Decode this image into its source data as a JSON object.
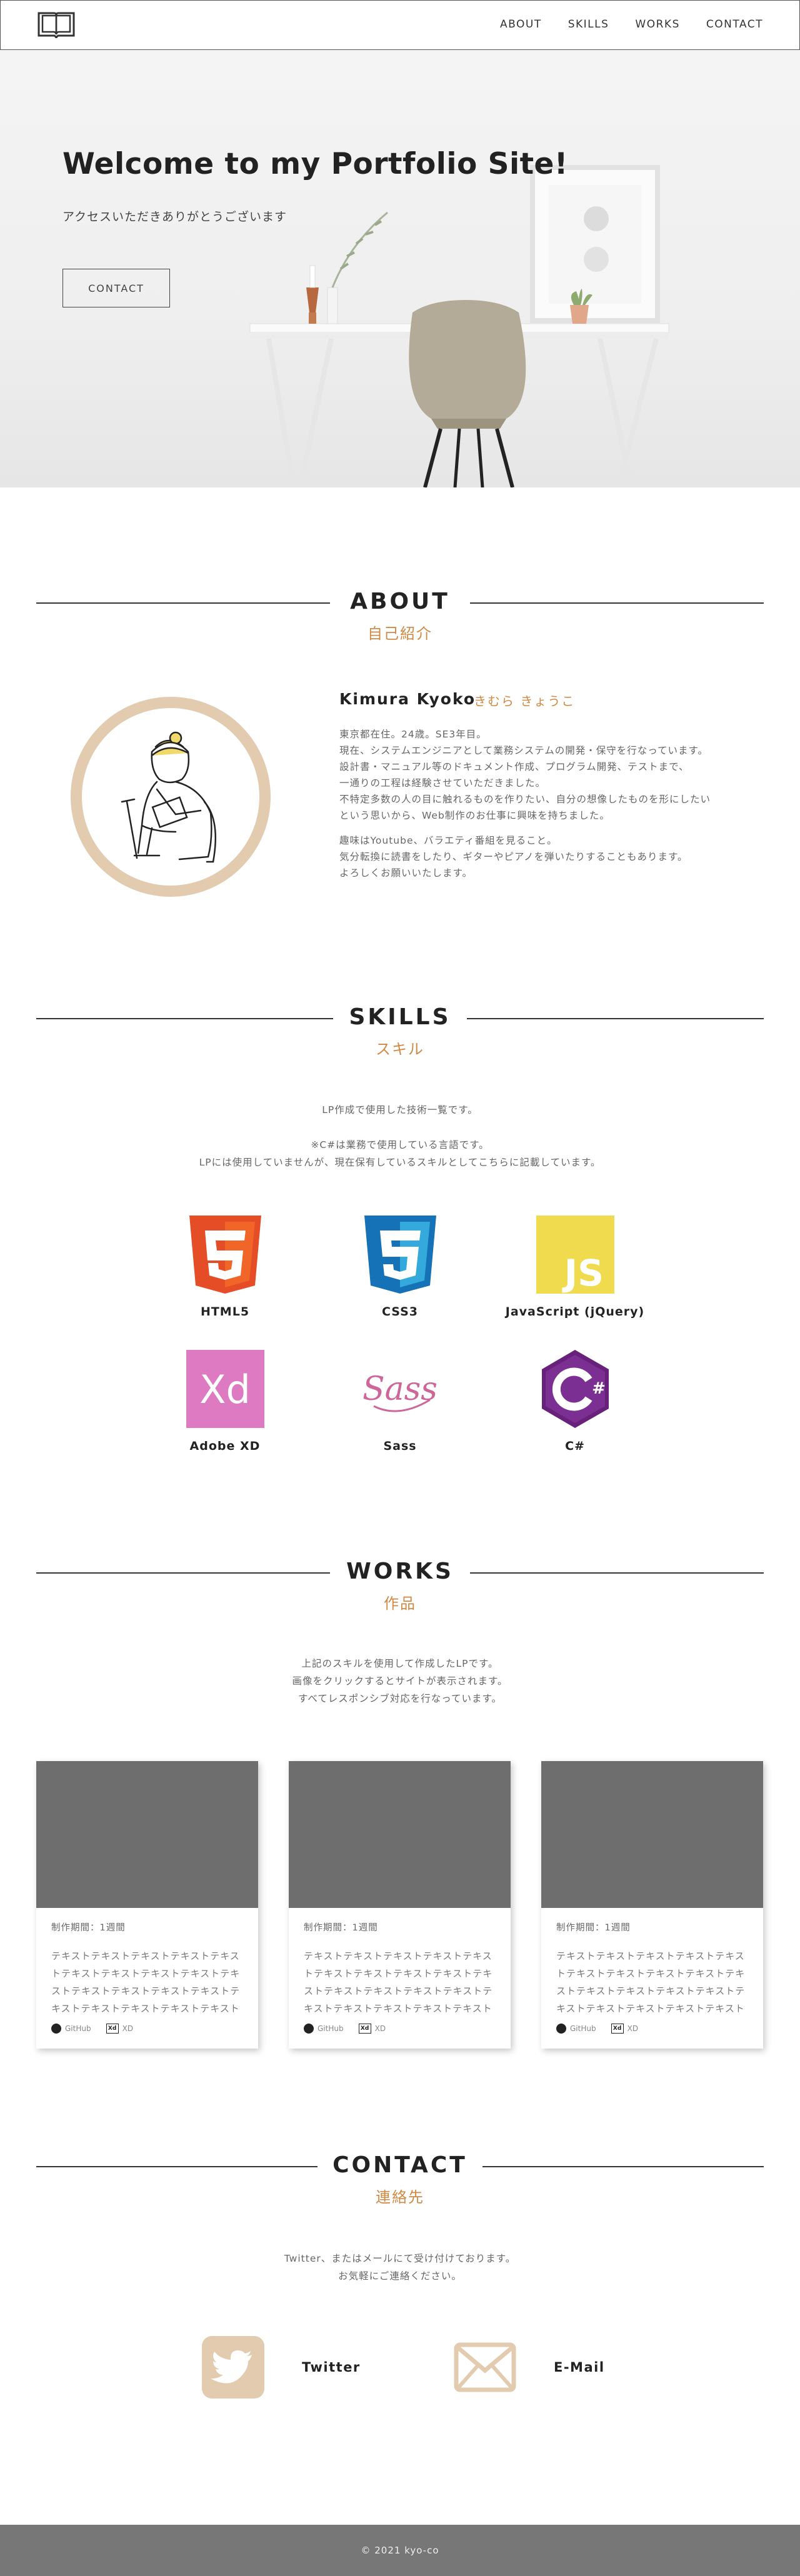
{
  "header": {
    "nav": [
      "ABOUT",
      "SKILLS",
      "WORKS",
      "CONTACT"
    ]
  },
  "hero": {
    "title": "Welcome to my Portfolio Site!",
    "subtitle": "アクセスいただきありがとうございます",
    "button": "CONTACT"
  },
  "about": {
    "title": "ABOUT",
    "subtitle": "自己紹介",
    "name": "Kimura Kyoko",
    "kana": "きむら きょうこ",
    "paragraph1": [
      "東京都在住。24歳。SE3年目。",
      "現在、システムエンジニアとして業務システムの開発・保守を行なっています。",
      "設計書・マニュアル等のドキュメント作成、プログラム開発、テストまで、",
      "一通りの工程は経験させていただきました。",
      "不特定多数の人の目に触れるものを作りたい、自分の想像したものを形にしたい",
      "という思いから、Web制作のお仕事に興味を持ちました。"
    ],
    "paragraph2": [
      "趣味はYoutube、バラエティ番組を見ること。",
      "気分転換に読書をしたり、ギターやピアノを弾いたりすることもあります。",
      "よろしくお願いいたします。"
    ]
  },
  "skills": {
    "title": "SKILLS",
    "subtitle": "スキル",
    "intro": "LP作成で使用した技術一覧です。",
    "note1": "※C#は業務で使用している言語です。",
    "note2": "LPには使用していませんが、現在保有しているスキルとしてこちらに記載しています。",
    "items": [
      "HTML5",
      "CSS3",
      "JavaScript (jQuery)",
      "Adobe XD",
      "Sass",
      "C#"
    ],
    "icons": [
      "html5-icon",
      "css3-icon",
      "javascript-icon",
      "adobe-xd-icon",
      "sass-icon",
      "csharp-icon"
    ]
  },
  "works": {
    "title": "WORKS",
    "subtitle": "作品",
    "intro1": "上記のスキルを使用して作成したLPです。",
    "intro2": "画像をクリックするとサイトが表示されます。",
    "intro3": "すべてレスポンシブ対応を行なっています。",
    "cards": [
      {
        "period": "制作期間：1週間",
        "desc": "テキストテキストテキストテキストテキストテキストテキストテキストテキストテキストテキストテキストテキストテキストテキストテキストテキストテキストテキストテキスト",
        "github": "GitHub",
        "xd": "XD"
      },
      {
        "period": "制作期間：1週間",
        "desc": "テキストテキストテキストテキストテキストテキストテキストテキストテキストテキストテキストテキストテキストテキストテキストテキストテキストテキストテキストテキスト",
        "github": "GitHub",
        "xd": "XD"
      },
      {
        "period": "制作期間：1週間",
        "desc": "テキストテキストテキストテキストテキストテキストテキストテキストテキストテキストテキストテキストテキストテキストテキストテキストテキストテキストテキストテキスト",
        "github": "GitHub",
        "xd": "XD"
      }
    ]
  },
  "contact": {
    "title": "CONTACT",
    "subtitle": "連絡先",
    "intro1": "Twitter、またはメールにて受け付けております。",
    "intro2": "お気軽にご連絡ください。",
    "twitter": "Twitter",
    "email": "E-Mail"
  },
  "footer": {
    "copyright": "© 2021 kyo-co"
  },
  "colors": {
    "accent": "#d08a45",
    "avatar_ring": "#e3cbb0",
    "footer_bg": "#777777",
    "thumb": "#6e6e6e"
  }
}
